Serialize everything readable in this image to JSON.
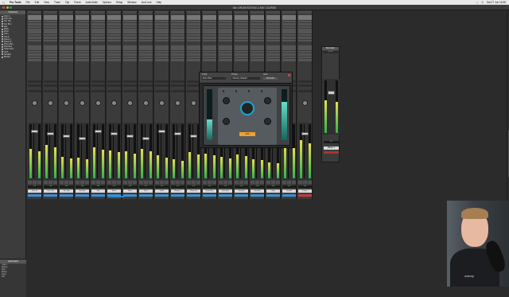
{
  "menubar": {
    "app": "Pro Tools",
    "items": [
      "File",
      "Edit",
      "View",
      "Track",
      "Clip",
      "Event",
      "AudioSuite",
      "Options",
      "Setup",
      "Window",
      "Avid Link",
      "Help"
    ],
    "clock": "Sat 27 Jun 16:56"
  },
  "window": {
    "title": "Mix: DRUM EDITING & MIX COURSE"
  },
  "left_panel": {
    "tracks_header": "TRACKS",
    "tracks": [
      "Kick In",
      "Kick Out",
      "Snr Top",
      "Snr Btm",
      "Hat",
      "Rack",
      "Floor",
      "OH L",
      "OH R",
      "Room L",
      "Room R",
      "Drum Bus",
      "Kick Bus",
      "Snare Bus",
      "Verb",
      "Parallel",
      "Master"
    ],
    "groups_header": "GROUPS",
    "groups": [
      "<ALL>",
      "Drums",
      "Kick",
      "Snare",
      "Toms",
      "OH"
    ]
  },
  "mixer": {
    "strips": [
      {
        "name": "Kick In",
        "volume": "-2.1",
        "color": "#3b8fd6",
        "meter": 0.55
      },
      {
        "name": "Kick Out",
        "volume": "-4.0",
        "color": "#3b8fd6",
        "meter": 0.62
      },
      {
        "name": "Snr Top",
        "volume": "-3.3",
        "color": "#3b8fd6",
        "meter": 0.4
      },
      {
        "name": "Snr Btm",
        "volume": "-8.0",
        "color": "#3b8fd6",
        "meter": 0.38
      },
      {
        "name": "Hat",
        "volume": "-6.5",
        "color": "#3b8fd6",
        "meter": 0.58
      },
      {
        "name": "Rack",
        "volume": "-1.2",
        "color": "#3b8fd6",
        "meter": 0.52
      },
      {
        "name": "Floor",
        "volume": "-0.9",
        "color": "#3b8fd6",
        "meter": 0.5
      },
      {
        "name": "OH L",
        "volume": "-5.1",
        "color": "#3b8fd6",
        "meter": 0.55
      },
      {
        "name": "OH R",
        "volume": "-5.1",
        "color": "#3b8fd6",
        "meter": 0.42
      },
      {
        "name": "Room L",
        "volume": "-7.2",
        "color": "#3b8fd6",
        "meter": 0.35
      },
      {
        "name": "Room R",
        "volume": "-7.2",
        "color": "#3b8fd6",
        "meter": 0.48
      },
      {
        "name": "Drum Bus",
        "volume": "0.0",
        "color": "#3b8fd6",
        "meter": 0.46
      },
      {
        "name": "Kick Bus",
        "volume": "-1.5",
        "color": "#3b8fd6",
        "meter": 0.4
      },
      {
        "name": "Snr Bus",
        "volume": "-2.0",
        "color": "#3b8fd6",
        "meter": 0.44
      },
      {
        "name": "Tom Bus",
        "volume": "-3.0",
        "color": "#3b8fd6",
        "meter": 0.36
      },
      {
        "name": "Verb",
        "volume": "-9.0",
        "color": "#3b8fd6",
        "meter": 0.3
      },
      {
        "name": "Parallel",
        "volume": "-6.0",
        "color": "#3b8fd6",
        "meter": 0.6
      },
      {
        "name": "Drums",
        "volume": "0.0",
        "color": "#c23b3b",
        "meter": 0.7
      }
    ]
  },
  "plugin": {
    "track_label": "Track",
    "preset_label": "Preset",
    "auto_label": "Auto",
    "track_name": "Drum Bus",
    "preset_name": "<factory default>",
    "bypass": "BYPASS",
    "lcd": "1176"
  },
  "master": {
    "header": "Mst Fader",
    "io": [
      "Out 1-2"
    ],
    "volume": "0.0",
    "name": "Master 1",
    "meter": 0.62
  },
  "webcam": {
    "brand": "udemy"
  },
  "colors": {
    "accent": "#15a8d6",
    "meter_top": "#e8e24a",
    "meter_bottom": "#2fb34a"
  }
}
